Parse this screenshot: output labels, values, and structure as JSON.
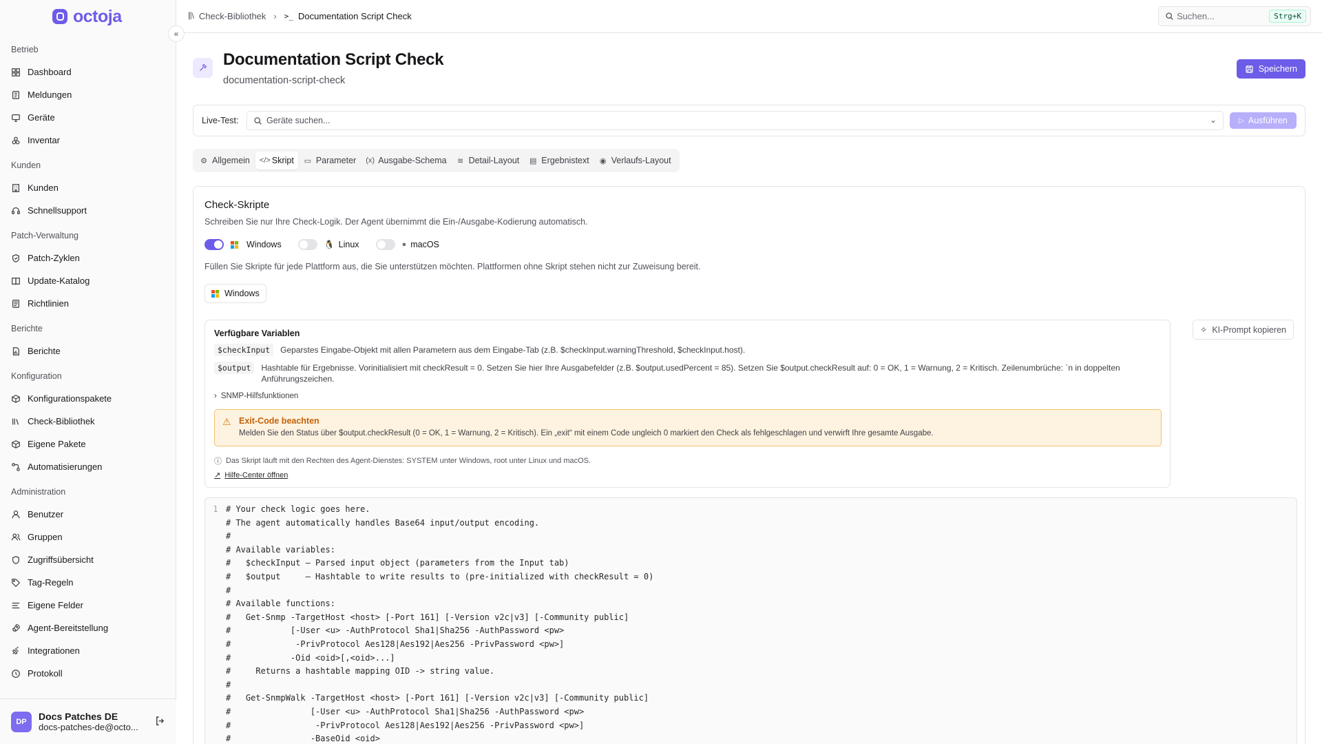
{
  "brand": {
    "name": "octoja",
    "color": "#6d5ce8"
  },
  "sidebar": {
    "sections": [
      {
        "title": "Betrieb",
        "items": [
          {
            "label": "Dashboard",
            "icon": "dashboard-icon"
          },
          {
            "label": "Meldungen",
            "icon": "notebook-icon"
          },
          {
            "label": "Geräte",
            "icon": "monitor-icon"
          },
          {
            "label": "Inventar",
            "icon": "boxes-icon"
          }
        ]
      },
      {
        "title": "Kunden",
        "items": [
          {
            "label": "Kunden",
            "icon": "building-icon"
          },
          {
            "label": "Schnellsupport",
            "icon": "headset-icon"
          }
        ]
      },
      {
        "title": "Patch-Verwaltung",
        "items": [
          {
            "label": "Patch-Zyklen",
            "icon": "shield-check-icon"
          },
          {
            "label": "Update-Katalog",
            "icon": "book-icon"
          },
          {
            "label": "Richtlinien",
            "icon": "scroll-icon"
          }
        ]
      },
      {
        "title": "Berichte",
        "items": [
          {
            "label": "Berichte",
            "icon": "file-chart-icon"
          }
        ]
      },
      {
        "title": "Konfiguration",
        "items": [
          {
            "label": "Konfigurationspakete",
            "icon": "package-icon"
          },
          {
            "label": "Check-Bibliothek",
            "icon": "library-icon"
          },
          {
            "label": "Eigene Pakete",
            "icon": "package-icon"
          },
          {
            "label": "Automatisierungen",
            "icon": "workflow-icon"
          }
        ]
      },
      {
        "title": "Administration",
        "items": [
          {
            "label": "Benutzer",
            "icon": "user-icon"
          },
          {
            "label": "Gruppen",
            "icon": "users-icon"
          },
          {
            "label": "Zugriffsübersicht",
            "icon": "shield-icon"
          },
          {
            "label": "Tag-Regeln",
            "icon": "tag-icon"
          },
          {
            "label": "Eigene Felder",
            "icon": "list-icon"
          },
          {
            "label": "Agent-Bereitstellung",
            "icon": "rocket-icon"
          },
          {
            "label": "Integrationen",
            "icon": "plug-icon"
          },
          {
            "label": "Protokoll",
            "icon": "history-icon"
          }
        ]
      }
    ],
    "collapse_icon": "«"
  },
  "user": {
    "initials": "DP",
    "name": "Docs Patches DE",
    "email": "docs-patches-de@octo..."
  },
  "breadcrumb": {
    "parent": "Check-Bibliothek",
    "current": "Documentation Script Check"
  },
  "search": {
    "placeholder": "Suchen...",
    "shortcut": "Strg+K"
  },
  "page": {
    "title": "Documentation Script Check",
    "slug": "documentation-script-check",
    "save_label": "Speichern"
  },
  "livetest": {
    "label": "Live-Test:",
    "placeholder": "Geräte suchen...",
    "run_label": "Ausführen"
  },
  "tabs": [
    {
      "label": "Allgemein",
      "icon": "⚙",
      "active": false
    },
    {
      "label": "Skript",
      "icon": "</>",
      "active": true
    },
    {
      "label": "Parameter",
      "icon": "▭",
      "active": false
    },
    {
      "label": "Ausgabe-Schema",
      "icon": "(x)",
      "active": false
    },
    {
      "label": "Detail-Layout",
      "icon": "≋",
      "active": false
    },
    {
      "label": "Ergebnistext",
      "icon": "▤",
      "active": false
    },
    {
      "label": "Verlaufs-Layout",
      "icon": "◉",
      "active": false
    }
  ],
  "scripts": {
    "title": "Check-Skripte",
    "description": "Schreiben Sie nur Ihre Check-Logik. Der Agent übernimmt die Ein-/Ausgabe-Kodierung automatisch.",
    "platforms": [
      {
        "label": "Windows",
        "enabled": true
      },
      {
        "label": "Linux",
        "enabled": false
      },
      {
        "label": "macOS",
        "enabled": false
      }
    ],
    "note": "Füllen Sie Skripte für jede Plattform aus, die Sie unterstützen möchten. Plattformen ohne Skript stehen nicht zur Zuweisung bereit.",
    "active_platform": "Windows",
    "ai_prompt_label": "KI-Prompt kopieren"
  },
  "variables": {
    "title": "Verfügbare Variablen",
    "items": [
      {
        "name": "$checkInput",
        "desc": "Geparstes Eingabe-Objekt mit allen Parametern aus dem Eingabe-Tab (z.B. $checkInput.warningThreshold, $checkInput.host)."
      },
      {
        "name": "$output",
        "desc": "Hashtable für Ergebnisse. Vorinitialisiert mit checkResult = 0. Setzen Sie hier Ihre Ausgabefelder (z.B. $output.usedPercent = 85). Setzen Sie $output.checkResult auf: 0 = OK, 1 = Warnung, 2 = Kritisch. Zeilenumbrüche: `n in doppelten Anführungszeichen."
      }
    ],
    "snmp_label": "SNMP-Hilfsfunktionen",
    "warning_title": "Exit-Code beachten",
    "warning_text": "Melden Sie den Status über $output.checkResult (0 = OK, 1 = Warnung, 2 = Kritisch). Ein „exit“ mit einem Code ungleich 0 markiert den Check als fehlgeschlagen und verwirft Ihre gesamte Ausgabe.",
    "runs_as": "Das Skript läuft mit den Rechten des Agent-Dienstes: SYSTEM unter Windows, root unter Linux und macOS.",
    "help_link": "Hilfe-Center öffnen"
  },
  "editor": {
    "first_line_number": "1",
    "lines": [
      "# Your check logic goes here.",
      "# The agent automatically handles Base64 input/output encoding.",
      "#",
      "# Available variables:",
      "#   $checkInput — Parsed input object (parameters from the Input tab)",
      "#   $output     — Hashtable to write results to (pre-initialized with checkResult = 0)",
      "#",
      "# Available functions:",
      "#   Get-Snmp -TargetHost <host> [-Port 161] [-Version v2c|v3] [-Community public]",
      "#            [-User <u> -AuthProtocol Sha1|Sha256 -AuthPassword <pw>",
      "#             -PrivProtocol Aes128|Aes192|Aes256 -PrivPassword <pw>]",
      "#            -Oid <oid>[,<oid>...]",
      "#     Returns a hashtable mapping OID -> string value.",
      "#",
      "#   Get-SnmpWalk -TargetHost <host> [-Port 161] [-Version v2c|v3] [-Community public]",
      "#                [-User <u> -AuthProtocol Sha1|Sha256 -AuthPassword <pw>",
      "#                 -PrivProtocol Aes128|Aes192|Aes256 -PrivPassword <pw>]",
      "#                -BaseOid <oid>"
    ]
  }
}
